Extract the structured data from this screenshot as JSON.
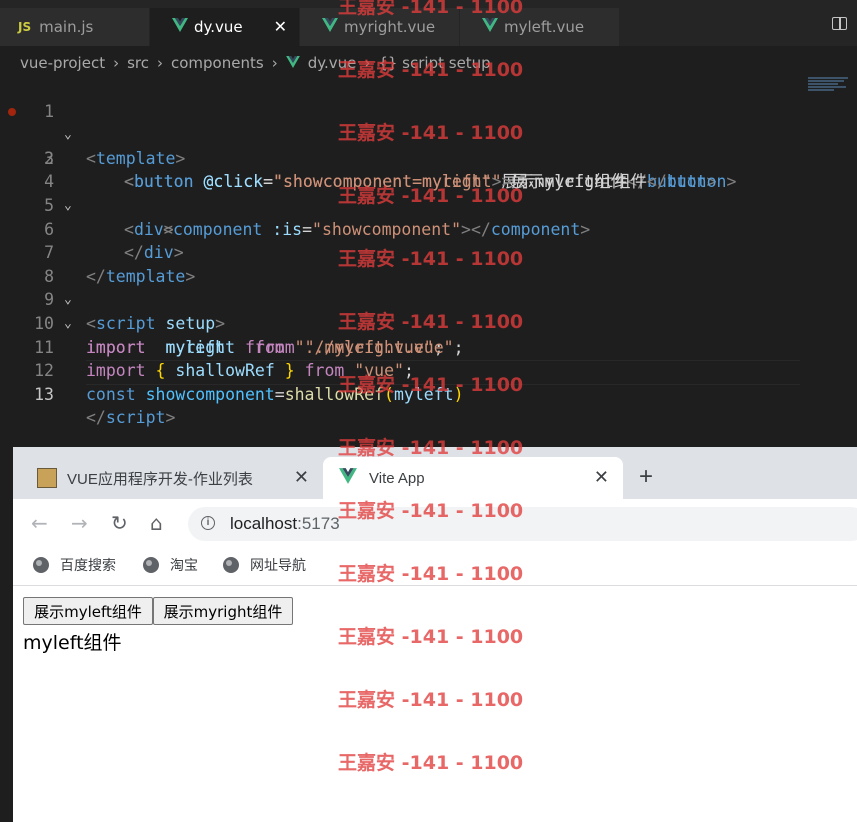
{
  "vscode": {
    "tabs": [
      {
        "label": "main.js",
        "icon": "js-icon",
        "icon_text": "JS"
      },
      {
        "label": "dy.vue",
        "icon": "vue-icon",
        "active": true
      },
      {
        "label": "myright.vue",
        "icon": "vue-icon"
      },
      {
        "label": "myleft.vue",
        "icon": "vue-icon"
      }
    ],
    "close_glyph": "✕",
    "breadcrumb": [
      "vue-project",
      "src",
      "components",
      "dy.vue",
      "{} script setup"
    ],
    "line_numbers": [
      "1",
      "2",
      "3",
      "4",
      "5",
      "6",
      "7",
      "8",
      "9",
      "10",
      "11",
      "12",
      "13"
    ],
    "current_line": "13",
    "code": {
      "l1": [
        "<",
        "template",
        ">"
      ],
      "l2": [
        "<",
        "button",
        " @click",
        "=",
        "\"showcomponent=myleft\"",
        ">",
        "展示myleft组件",
        "</",
        "button",
        ">"
      ],
      "l3": [
        "<",
        "button",
        " @click",
        "=",
        "\"showcomponent=myright\"",
        ">",
        "展示myright组件",
        "</",
        "button",
        ">"
      ],
      "l4": [
        "<",
        "div",
        ">"
      ],
      "l5": [
        "<",
        "component",
        " :is",
        "=",
        "\"showcomponent\"",
        "></",
        "component",
        ">"
      ],
      "l6": [
        "</",
        "div",
        ">"
      ],
      "l7": [
        "</",
        "template",
        ">"
      ],
      "l8": [
        "<",
        "script",
        " setup",
        ">"
      ],
      "l9": [
        "import",
        "  myleft  ",
        "from",
        " \"./myleft.vue\"",
        ";"
      ],
      "l10": [
        "import",
        "  myright  ",
        "from",
        " \"./myright.vue\"",
        ";"
      ],
      "l11": [
        "import",
        " { ",
        "shallowRef",
        " } ",
        "from",
        " \"vue\"",
        ";"
      ],
      "l12": [
        "const",
        " showcomponent",
        "=",
        "shallowRef",
        "(",
        "myleft",
        ")"
      ],
      "l13": [
        "</",
        "script",
        ">"
      ]
    }
  },
  "browser": {
    "tabs": [
      {
        "title": "VUE应用程序开发-作业列表",
        "icon": "tiger-favicon-icon"
      },
      {
        "title": "Vite App",
        "icon": "vue-icon",
        "active": true
      }
    ],
    "new_tab": "+",
    "url_host": "localhost",
    "url_port": ":5173",
    "bookmarks": [
      "百度搜索",
      "淘宝",
      "网址导航"
    ],
    "page": {
      "buttons": [
        "展示myleft组件",
        "展示myright组件"
      ],
      "component_text": "myleft组件"
    }
  },
  "watermark": "王嘉安 -141 - 1100",
  "colors": {
    "editor_bg": "#1e1e1e",
    "tag": "#569cd6",
    "attr": "#9cdcfe",
    "string": "#ce9178",
    "keyword": "#c586c0",
    "function": "#dcdcaa",
    "vue_green": "#41b883",
    "watermark": "#e23c3c"
  }
}
